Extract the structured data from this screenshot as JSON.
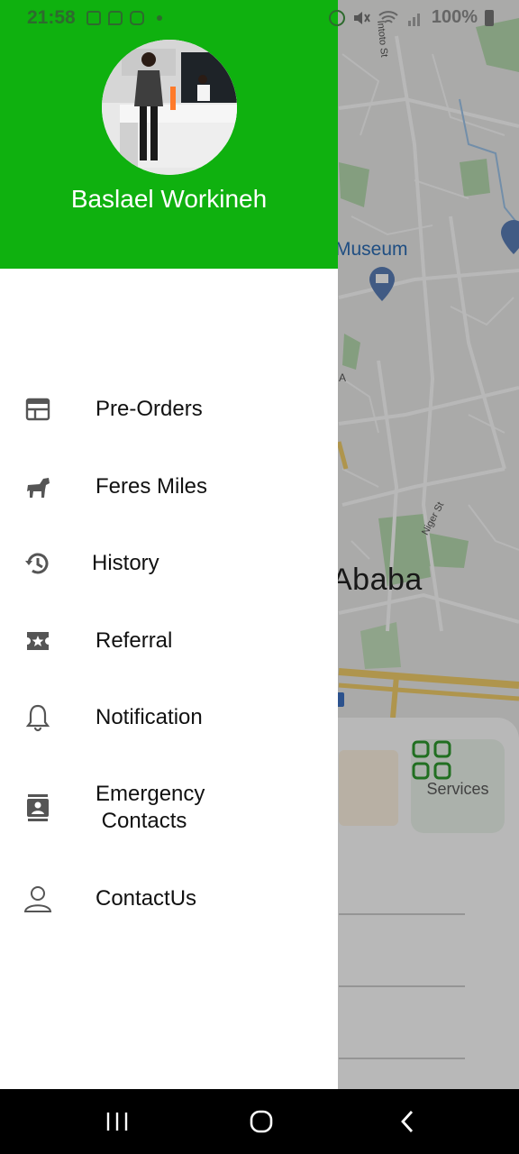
{
  "status_bar": {
    "time": "21:58",
    "battery": "100%",
    "left_icons": [
      "gallery-icon",
      "message-icon",
      "instagram-icon",
      "dot-icon"
    ],
    "right_icons": [
      "alarm-icon",
      "mute-icon",
      "wifi-icon",
      "signal-icon",
      "battery-icon"
    ]
  },
  "drawer": {
    "user_name": "Baslael Workineh",
    "header_color": "#0fb10f",
    "menu": [
      {
        "label": "Pre-Orders",
        "icon": "calendar-table-icon"
      },
      {
        "label": "Feres Miles",
        "icon": "horse-icon"
      },
      {
        "label": "History",
        "icon": "history-icon"
      },
      {
        "label": "Referral",
        "icon": "ticket-star-icon"
      },
      {
        "label": "Notification",
        "icon": "bell-icon"
      },
      {
        "label": "Emergency\n Contacts",
        "icon": "contact-book-icon"
      },
      {
        "label": "ContactUs",
        "icon": "person-icon"
      }
    ]
  },
  "map": {
    "labels": {
      "museum": "Museum",
      "city": "Ababa",
      "street_1": "Intoto St",
      "street_2": "Niger St",
      "marker_a": "A"
    }
  },
  "services": {
    "label": "Services"
  },
  "nav_bar": {
    "icons": [
      "recent-apps-icon",
      "home-icon",
      "back-icon"
    ]
  }
}
